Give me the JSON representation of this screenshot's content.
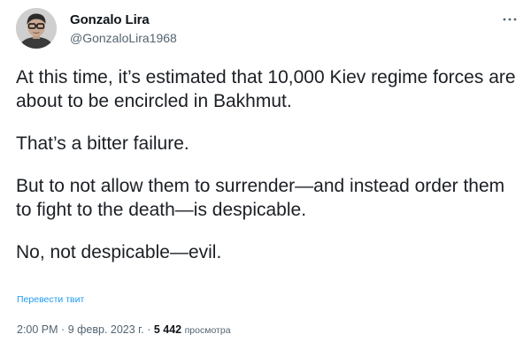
{
  "author": {
    "display_name": "Gonzalo Lira",
    "handle": "@GonzaloLira1968",
    "avatar_icon": "user-avatar-photo"
  },
  "menu": {
    "more_icon": "ellipsis-icon"
  },
  "tweet": {
    "paragraphs": [
      "At this time, it’s estimated that 10,000 Kiev regime forces are about to be encircled in Bakhmut.",
      "That’s a bitter failure.",
      "But to not allow them to surrender—and instead order them to fight to the death—is despicable.",
      "No, not despicable—evil."
    ],
    "translate_label": "Перевести твит"
  },
  "meta": {
    "time": "2:00 PM",
    "separator1": "·",
    "date": "9 февр. 2023 г.",
    "separator2": "·",
    "views_count": "5 442",
    "views_label": "просмотра"
  },
  "colors": {
    "link": "#1d9bf0",
    "secondary_text": "#536471",
    "primary_text": "#0f1419"
  }
}
